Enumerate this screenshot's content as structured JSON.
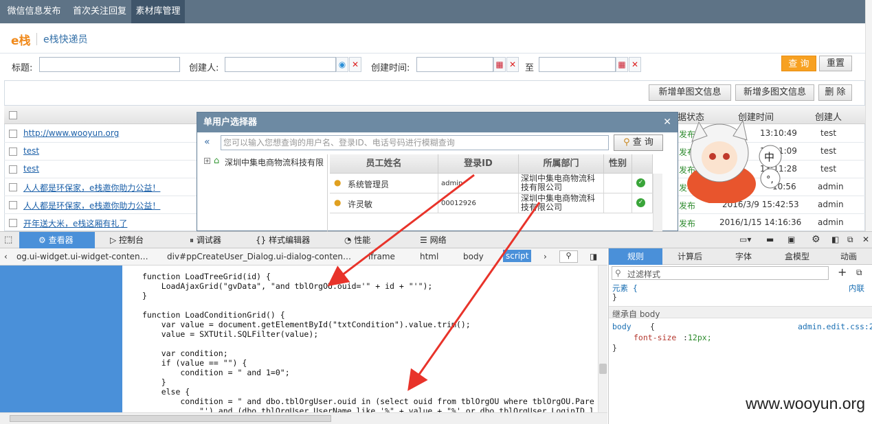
{
  "nav": {
    "tab1": "微信信息发布",
    "tab2": "首次关注回复",
    "tab3": "素材库管理"
  },
  "brand": {
    "logo": "e栈",
    "name": "e栈快递员"
  },
  "filter": {
    "title_label": "标题:",
    "creator_label": "创建人:",
    "time_label": "创建时间:",
    "to_label": "至",
    "query_label": "查 询",
    "reset_label": "重置"
  },
  "toolbar": {
    "add_single": "新增单图文信息",
    "add_multi": "新增多图文信息",
    "delete": "删 除"
  },
  "grid": {
    "headers": {
      "status": "据状态",
      "created": "创建时间",
      "creator": "创建人"
    },
    "rows": [
      {
        "title": "http://www.wooyun.org",
        "status": "发布",
        "time": "13:10:49",
        "creator": "test"
      },
      {
        "title": "test",
        "status": "发布",
        "time": "13:11:09",
        "creator": "test"
      },
      {
        "title": "test",
        "status": "发布",
        "time": "13:11:28",
        "creator": "test"
      },
      {
        "title": "人人都是环保家，e栈邀你助力公益！",
        "status": "发布",
        "time": "10:56",
        "creator": "admin"
      },
      {
        "title": "人人都是环保家，e栈邀你助力公益！",
        "status": "发布",
        "time": "2016/3/9 15:42:53",
        "creator": "admin"
      },
      {
        "title": "开年送大米，e栈这厢有礼了",
        "status": "发布",
        "time": "2016/1/15 14:16:36",
        "creator": "admin"
      }
    ]
  },
  "dialog": {
    "title": "单用户选择器",
    "search_placeholder": "您可以输入您想查询的用户名、登录ID、电话号码进行模糊查询",
    "query_label": "查 询",
    "tree_root": "深圳中集电商物流科技有限",
    "headers": {
      "name": "员工姓名",
      "login": "登录ID",
      "dept": "所属部门",
      "gender": "性别"
    },
    "users": [
      {
        "name": "系统管理员",
        "login": "admin",
        "dept": "深圳中集电商物流科技有限公司"
      },
      {
        "name": "许灵敏",
        "login": "00012926",
        "dept": "深圳中集电商物流科技有限公司"
      }
    ]
  },
  "devtools": {
    "tabs": {
      "inspector": "查看器",
      "console": "控制台",
      "debugger": "调试器",
      "style": "样式编辑器",
      "perf": "性能",
      "network": "网络"
    },
    "breadcrumb": {
      "b1": "og.ui-widget.ui-widget-conten…",
      "b2": "div#ppCreateUser_Dialog.ui-dialog-conten…",
      "b3": "iframe",
      "b4": "html",
      "b5": "body",
      "b6": "script"
    },
    "code": "function LoadTreeGrid(id) {\n    LoadAjaxGrid(\"gvData\", \"and tblOrgOU.ouid='\" + id + \"'\");\n}\n\nfunction LoadConditionGrid() {\n    var value = document.getElementById(\"txtCondition\").value.trim();\n    value = SXTUtil.SQLFilter(value);\n\n    var condition;\n    if (value == \"\") {\n        condition = \" and 1=0\";\n    }\n    else {\n        condition = \" and dbo.tblOrgUser.ouid in (select ouid from tblOrgOU where tblOrgOU.Pare\n            \"') and (dbo.tblOrgUser.UserName like '%\" + value + \"%' or dbo.tblOrgUser.LoginID l",
    "rtabs": {
      "rules": "规则",
      "computed": "计算后",
      "fonts": "字体",
      "box": "盒模型",
      "anim": "动画"
    },
    "filter_placeholder": "过滤样式",
    "element_rule": "元素 {",
    "element_close": "}",
    "inline_label": "内联",
    "inherited": "继承自 body",
    "body_rule": "body",
    "body_brace": "{",
    "prop": "font-size",
    "propval": "12px;",
    "css_source": "admin.edit.css:2",
    "close_brace": "}"
  },
  "watermark": "www.wooyun.org",
  "colors": {
    "nav": "#5e7386",
    "accent": "#4a90d9",
    "orange": "#f7a122",
    "arrow": "#e8332a"
  }
}
